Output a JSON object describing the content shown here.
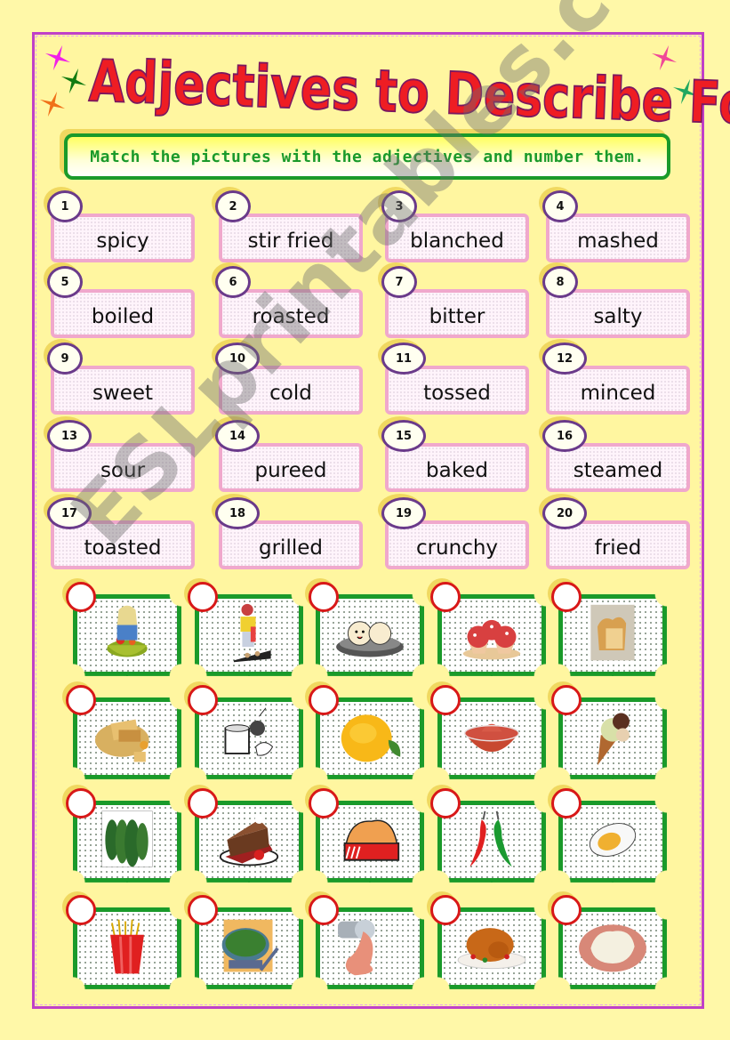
{
  "title": "Adjectives to Describe Food",
  "instruction": "Match the pictures with the adjectives and number them.",
  "watermark": "ESLprintables.com",
  "colors": {
    "background": "#fff8a8",
    "title_red": "#ee1d23",
    "frame_magenta": "#c040c8",
    "instruction_green": "#1a9a2a",
    "word_card_pink": "#f0a8cc",
    "badge_purple": "#6a3a8a",
    "answer_circle_red": "#d81818"
  },
  "adjectives": [
    {
      "number": "1",
      "word": "spicy"
    },
    {
      "number": "2",
      "word": "stir fried"
    },
    {
      "number": "3",
      "word": "blanched"
    },
    {
      "number": "4",
      "word": "mashed"
    },
    {
      "number": "5",
      "word": "boiled"
    },
    {
      "number": "6",
      "word": "roasted"
    },
    {
      "number": "7",
      "word": "bitter"
    },
    {
      "number": "8",
      "word": "salty"
    },
    {
      "number": "9",
      "word": "sweet"
    },
    {
      "number": "10",
      "word": "cold"
    },
    {
      "number": "11",
      "word": "tossed"
    },
    {
      "number": "12",
      "word": "minced"
    },
    {
      "number": "13",
      "word": "sour"
    },
    {
      "number": "14",
      "word": "pureed"
    },
    {
      "number": "15",
      "word": "baked"
    },
    {
      "number": "16",
      "word": "steamed"
    },
    {
      "number": "17",
      "word": "toasted"
    },
    {
      "number": "18",
      "word": "grilled"
    },
    {
      "number": "19",
      "word": "crunchy"
    },
    {
      "number": "20",
      "word": "fried"
    }
  ],
  "pictures": [
    {
      "icon": "tossed-salad-icon",
      "answer": ""
    },
    {
      "icon": "grilling-man-icon",
      "answer": ""
    },
    {
      "icon": "steamed-buns-icon",
      "answer": ""
    },
    {
      "icon": "baked-muffins-icon",
      "answer": ""
    },
    {
      "icon": "toasted-bread-icon",
      "answer": ""
    },
    {
      "icon": "crackers-icon",
      "answer": ""
    },
    {
      "icon": "blender-pureeing-icon",
      "answer": ""
    },
    {
      "icon": "lemon-icon",
      "answer": ""
    },
    {
      "icon": "salsa-bowl-icon",
      "answer": ""
    },
    {
      "icon": "ice-cream-cone-icon",
      "answer": ""
    },
    {
      "icon": "bitter-gourd-icon",
      "answer": ""
    },
    {
      "icon": "chocolate-cake-icon",
      "answer": ""
    },
    {
      "icon": "fried-chicken-icon",
      "answer": ""
    },
    {
      "icon": "chili-peppers-icon",
      "answer": ""
    },
    {
      "icon": "boiled-egg-icon",
      "answer": ""
    },
    {
      "icon": "french-fries-icon",
      "answer": ""
    },
    {
      "icon": "stir-fry-wok-icon",
      "answer": ""
    },
    {
      "icon": "minced-meat-icon",
      "answer": ""
    },
    {
      "icon": "roast-turkey-icon",
      "answer": ""
    },
    {
      "icon": "mashed-potatoes-icon",
      "answer": ""
    }
  ]
}
